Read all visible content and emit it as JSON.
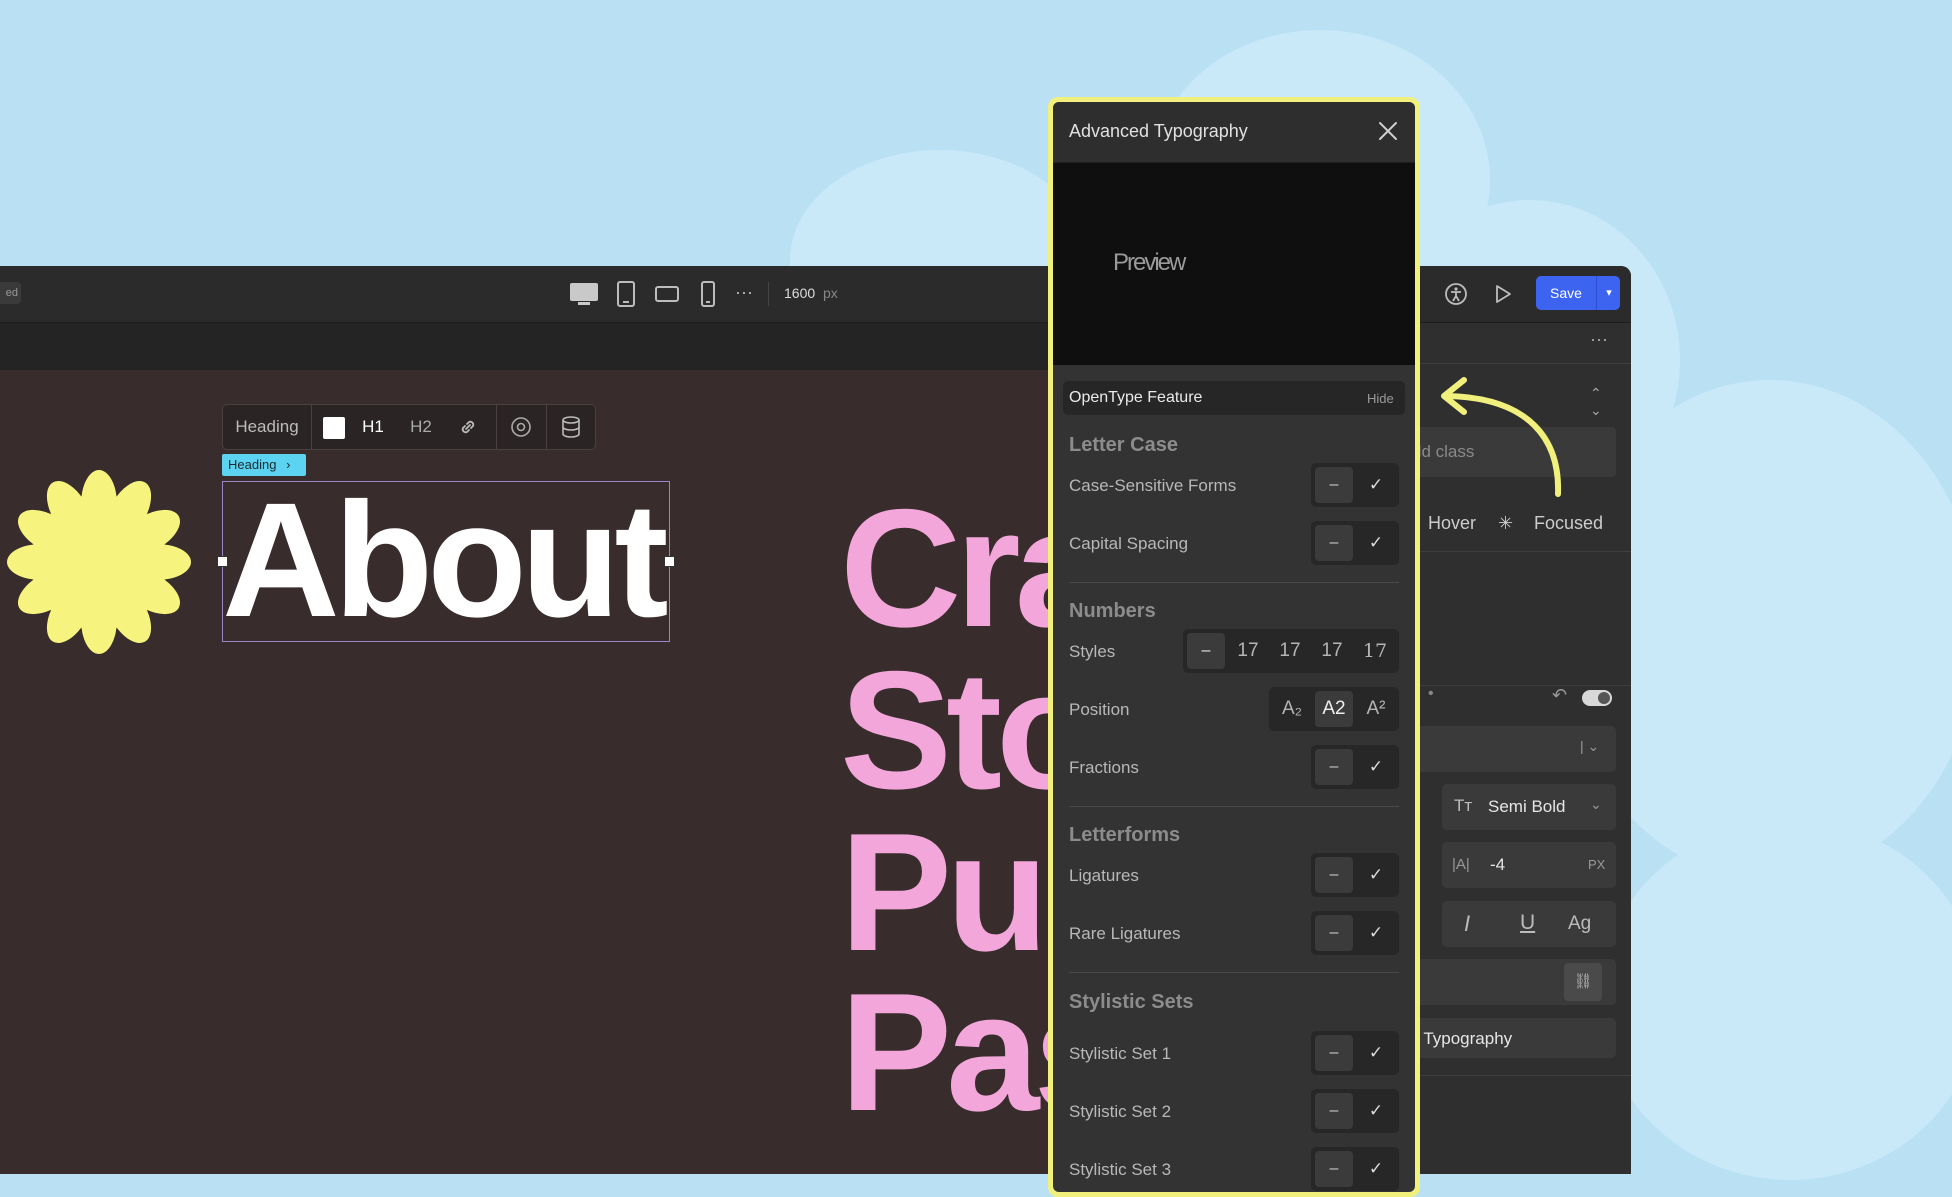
{
  "topbar": {
    "left_badge": "ed",
    "width_value": "1600",
    "width_unit": "px",
    "more_label": "···",
    "save_label": "Save"
  },
  "element_toolbar": {
    "type_label": "Heading",
    "h1_label": "H1",
    "h2_label": "H2",
    "badge_label": "Heading"
  },
  "canvas": {
    "about_text": "About",
    "pink_lines": [
      "Cra",
      "Sto",
      "Pur",
      "Pas"
    ]
  },
  "right_panel": {
    "more": "···",
    "add_class_placeholder": "dd class",
    "states": {
      "hover": "Hover",
      "focused": "Focused"
    },
    "font_weight": "Semi Bold",
    "letter_spacing_value": "-4",
    "letter_spacing_unit": "PX",
    "letter_spacing_icon_text": "|A|",
    "text_style_ag": "Ag",
    "adv_typography_label": "ed Typography",
    "cut_text": "s"
  },
  "typography_modal": {
    "title": "Advanced Typography",
    "preview_text": "Preview",
    "feature_bar_label": "OpenType Feature",
    "hide_label": "Hide",
    "toggle_minus": "–",
    "toggle_check": "✓",
    "sections": {
      "letter_case": "Letter Case",
      "numbers": "Numbers",
      "letterforms": "Letterforms",
      "stylistic_sets": "Stylistic Sets"
    },
    "rows": {
      "case_sensitive": "Case-Sensitive Forms",
      "capital_spacing": "Capital Spacing",
      "styles": "Styles",
      "position": "Position",
      "fractions": "Fractions",
      "ligatures": "Ligatures",
      "rare_ligatures": "Rare Ligatures",
      "stylistic_set_1": "Stylistic Set 1",
      "stylistic_set_2": "Stylistic Set 2",
      "stylistic_set_3": "Stylistic Set 3"
    },
    "styles_options": [
      "–",
      "17",
      "17",
      "17",
      "17"
    ],
    "position_options": [
      "A₂",
      "A2",
      "A²"
    ]
  },
  "colors": {
    "sky": "#b9e1f3",
    "accent_yellow": "#f1f07c",
    "pink_text": "#f2a6d9",
    "save_blue": "#3c64f0",
    "selection_cyan": "#5cd3f0"
  }
}
